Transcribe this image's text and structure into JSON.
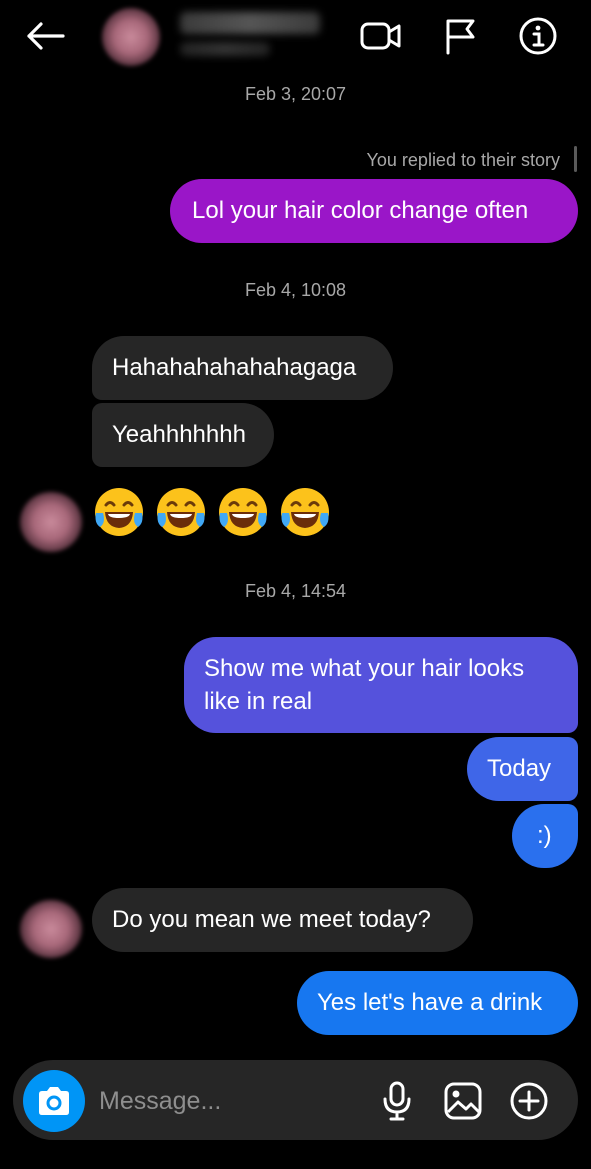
{
  "header": {
    "back_icon": "arrow-left-icon",
    "video_icon": "video-camera-icon",
    "flag_icon": "flag-icon",
    "info_icon": "info-icon"
  },
  "messages": {
    "ts1": "Feb 3, 20:07",
    "reply_note": "You replied to their story",
    "m1": "Lol your hair color change often",
    "ts2": "Feb 4, 10:08",
    "m2": "Hahahahahahahagaga",
    "m3": "Yeahhhhhhh",
    "ts3": "Feb 4, 14:54",
    "m4_line1": "Show me what your hair looks",
    "m4_line2": "like in real",
    "m5": "Today",
    "m6": ":)",
    "m7": "Do you mean we meet today?",
    "m8": "Yes let's have a drink"
  },
  "emoji": [
    "face-with-tears-of-joy",
    "face-with-tears-of-joy",
    "face-with-tears-of-joy",
    "face-with-tears-of-joy"
  ],
  "composer": {
    "placeholder": "Message...",
    "camera_icon": "camera-icon",
    "mic_icon": "microphone-icon",
    "gallery_icon": "image-icon",
    "add_icon": "plus-circle-icon"
  },
  "colors": {
    "background": "#000000",
    "purple_bubble": "#9a16c8",
    "blue_bubble": "#1777f0",
    "gray_bubble": "#262626",
    "accent": "#0095f6"
  }
}
